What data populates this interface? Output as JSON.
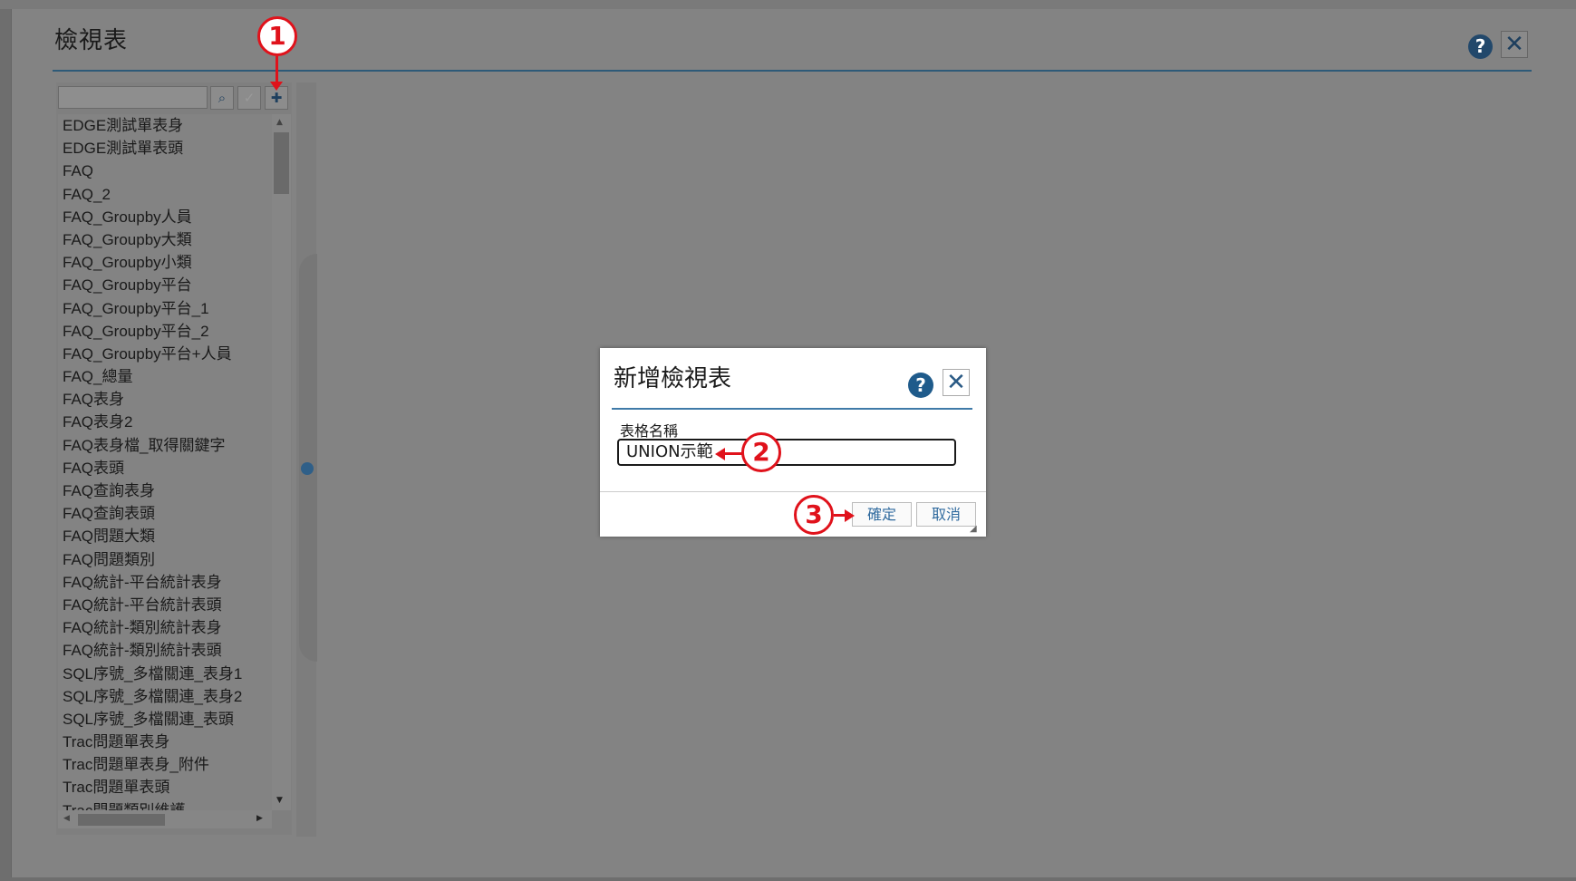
{
  "window": {
    "title": "檢視表",
    "help_icon": "question-circle-icon",
    "close_icon": "close-icon",
    "help_glyph": "?",
    "close_glyph": "✕"
  },
  "toolbar": {
    "search_icon": "search-icon",
    "confirm_icon": "check-icon",
    "add_icon": "plus-icon",
    "search_glyph": "⌕",
    "confirm_glyph": "✓",
    "add_glyph": "✚"
  },
  "list": {
    "items": [
      "EDGE測試單表身",
      "EDGE測試單表頭",
      "FAQ",
      "FAQ_2",
      "FAQ_Groupby人員",
      "FAQ_Groupby大類",
      "FAQ_Groupby小類",
      "FAQ_Groupby平台",
      "FAQ_Groupby平台_1",
      "FAQ_Groupby平台_2",
      "FAQ_Groupby平台+人員",
      "FAQ_總量",
      "FAQ表身",
      "FAQ表身2",
      "FAQ表身檔_取得關鍵字",
      "FAQ表頭",
      "FAQ查詢表身",
      "FAQ查詢表頭",
      "FAQ問題大類",
      "FAQ問題類別",
      "FAQ統計-平台統計表身",
      "FAQ統計-平台統計表頭",
      "FAQ統計-類別統計表身",
      "FAQ統計-類別統計表頭",
      "SQL序號_多檔關連_表身1",
      "SQL序號_多檔關連_表身2",
      "SQL序號_多檔關連_表頭",
      "Trac問題單表身",
      "Trac問題單表身_附件",
      "Trac問題單表頭",
      "Trac問題類別維護"
    ]
  },
  "dialog": {
    "title": "新增檢視表",
    "help_glyph": "?",
    "close_glyph": "✕",
    "field_label": "表格名稱",
    "field_value": "UNION示範",
    "ok_label": "確定",
    "cancel_label": "取消"
  },
  "markers": {
    "step1": "1",
    "step2": "2",
    "step3": "3",
    "color": "#e0121b"
  },
  "colors": {
    "overlay": "#838383",
    "accent": "#2e5a78",
    "link": "#2f6a9e"
  }
}
